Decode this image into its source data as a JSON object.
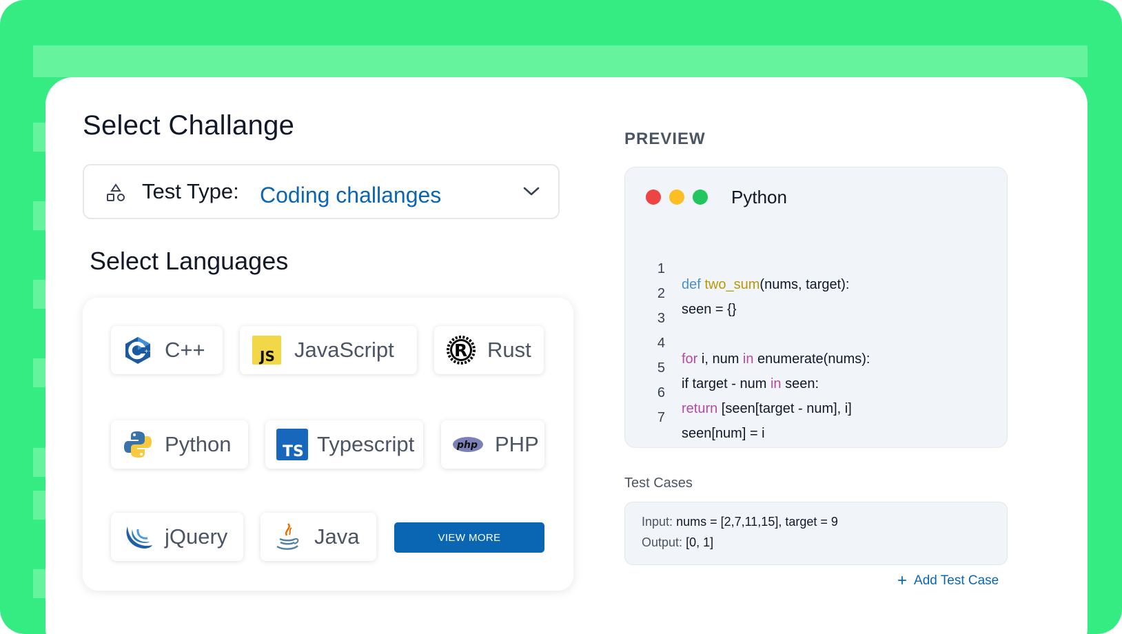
{
  "page": {
    "title": "Select Challange",
    "test_type": {
      "label": "Test Type:",
      "value": "Coding challanges"
    },
    "languages_title": "Select Languages",
    "languages": [
      {
        "name": "C++",
        "icon": "cplusplus-icon"
      },
      {
        "name": "JavaScript",
        "icon": "javascript-icon",
        "badge": "JS"
      },
      {
        "name": "Rust",
        "icon": "rust-icon",
        "badge": "R"
      },
      {
        "name": "Python",
        "icon": "python-icon"
      },
      {
        "name": "Typescript",
        "icon": "typescript-icon",
        "badge": "TS"
      },
      {
        "name": "PHP",
        "icon": "php-icon",
        "badge": "php"
      },
      {
        "name": "jQuery",
        "icon": "jquery-icon"
      },
      {
        "name": "Java",
        "icon": "java-icon"
      }
    ],
    "view_more_label": "VIEW MORE"
  },
  "preview": {
    "label": "PREVIEW",
    "language": "Python",
    "window_dots": [
      "#ef4444",
      "#fbbf24",
      "#22c55e"
    ],
    "code_lines": [
      {
        "num": "1",
        "text": "def two_sum(nums, target):"
      },
      {
        "num": "2",
        "text": "seen = {}"
      },
      {
        "num": "3",
        "text": ""
      },
      {
        "num": "4",
        "text": "for i, num in enumerate(nums):"
      },
      {
        "num": "5",
        "text": "if target - num in seen:"
      },
      {
        "num": "6",
        "text": "return [seen[target - num], i]"
      },
      {
        "num": "7",
        "text": "seen[num] = i"
      }
    ],
    "test_cases_label": "Test Cases",
    "test_case": {
      "input_label": "Input:",
      "input_value": "nums = [2,7,11,15], target = 9",
      "output_label": "Output:",
      "output_value": "[0, 1]"
    },
    "add_test_case_label": "Add Test Case"
  },
  "colors": {
    "background_green": "#34ec81",
    "accent_blue": "#0a66b3"
  }
}
